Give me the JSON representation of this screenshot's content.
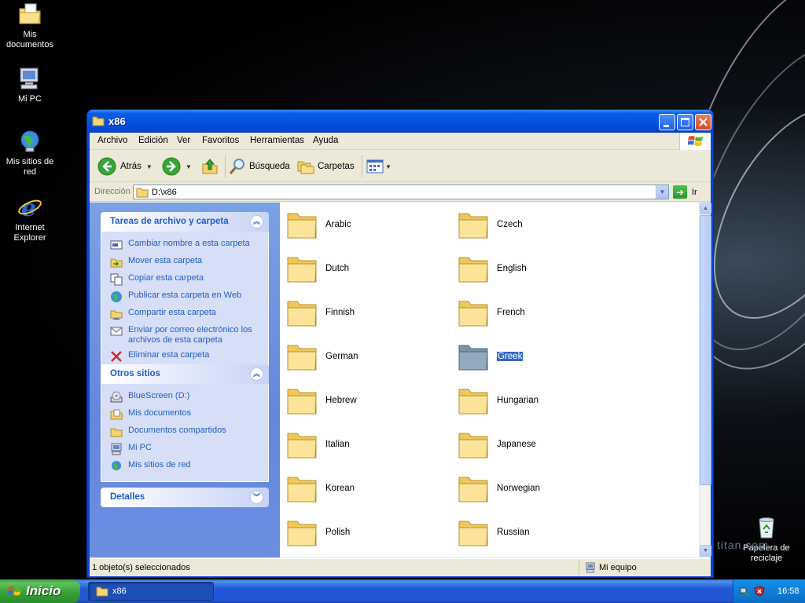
{
  "desktop": {
    "icons": [
      {
        "label": "Mis documentos",
        "icon": "my-documents-icon"
      },
      {
        "label": "Mi PC",
        "icon": "my-computer-icon"
      },
      {
        "label": "Mis sitios de red",
        "icon": "network-places-icon"
      },
      {
        "label": "Internet Explorer",
        "icon": "internet-explorer-icon"
      },
      {
        "label": "Papelera de reciclaje",
        "icon": "recycle-bin-icon"
      }
    ],
    "watermark": "titan.com"
  },
  "window": {
    "title": "x86",
    "menu": [
      "Archivo",
      "Edición",
      "Ver",
      "Favoritos",
      "Herramientas",
      "Ayuda"
    ],
    "toolbar": {
      "back_label": "Atrás",
      "search_label": "Búsqueda",
      "folders_label": "Carpetas"
    },
    "address": {
      "label": "Dirección",
      "value": "D:\\x86",
      "go_label": "Ir"
    },
    "tasks_panel": {
      "title": "Tareas de archivo y carpeta",
      "items": [
        {
          "label": "Cambiar nombre a esta carpeta",
          "icon": "rename-icon"
        },
        {
          "label": "Mover esta carpeta",
          "icon": "move-folder-icon"
        },
        {
          "label": "Copiar esta carpeta",
          "icon": "copy-folder-icon"
        },
        {
          "label": "Publicar esta carpeta en Web",
          "icon": "publish-web-icon"
        },
        {
          "label": "Compartir esta carpeta",
          "icon": "share-folder-icon"
        },
        {
          "label": "Enviar por correo electrónico los archivos de esta carpeta",
          "icon": "email-icon"
        },
        {
          "label": "Eliminar esta carpeta",
          "icon": "delete-icon"
        }
      ]
    },
    "places_panel": {
      "title": "Otros sitios",
      "items": [
        {
          "label": "BlueScreen (D:)",
          "icon": "cd-drive-icon"
        },
        {
          "label": "Mis documentos",
          "icon": "my-documents-icon"
        },
        {
          "label": "Documentos compartidos",
          "icon": "shared-documents-icon"
        },
        {
          "label": "Mi PC",
          "icon": "my-computer-icon"
        },
        {
          "label": "Mis sitios de red",
          "icon": "network-places-icon"
        }
      ]
    },
    "details_panel": {
      "title": "Detalles"
    },
    "folders": [
      {
        "name": "Arabic"
      },
      {
        "name": "Czech"
      },
      {
        "name": "Dutch"
      },
      {
        "name": "English"
      },
      {
        "name": "Finnish"
      },
      {
        "name": "French"
      },
      {
        "name": "German"
      },
      {
        "name": "Greek",
        "selected": true
      },
      {
        "name": "Hebrew"
      },
      {
        "name": "Hungarian"
      },
      {
        "name": "Italian"
      },
      {
        "name": "Japanese"
      },
      {
        "name": "Korean"
      },
      {
        "name": "Norwegian"
      },
      {
        "name": "Polish"
      },
      {
        "name": "Russian"
      }
    ],
    "status": {
      "left": "1 objeto(s) seleccionados",
      "right": "Mi equipo"
    }
  },
  "taskbar": {
    "start_label": "Inicio",
    "task_label": "x86",
    "clock": "16:58"
  },
  "colors": {
    "window_blue": "#0a46d8",
    "task_link": "#215dc6",
    "selection": "#316ac5",
    "start_green": "#37a137"
  }
}
